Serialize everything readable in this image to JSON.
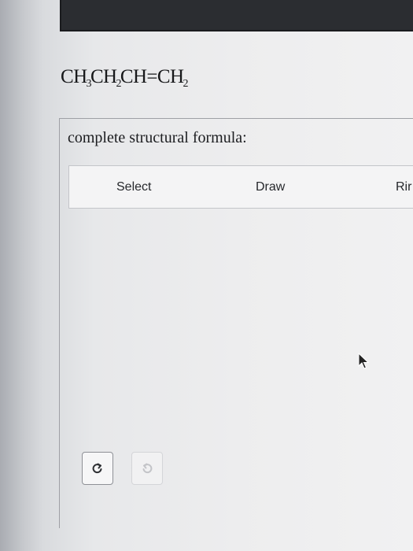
{
  "question": {
    "formula_parts": [
      {
        "text": "CH"
      },
      {
        "sub": "3"
      },
      {
        "text": "CH"
      },
      {
        "sub": "2"
      },
      {
        "text": "CH=CH"
      },
      {
        "sub": "2"
      }
    ],
    "prompt_label": "complete structural formula:"
  },
  "toolbar": {
    "select_label": "Select",
    "draw_label": "Draw",
    "rings_label": "Rir"
  },
  "history": {
    "undo_icon": "undo-icon",
    "redo_icon": "redo-icon"
  },
  "colors": {
    "top_bar": "#2b2d31",
    "panel_border": "#9ea0a5",
    "toolbar_bg": "#f4f4f5"
  }
}
